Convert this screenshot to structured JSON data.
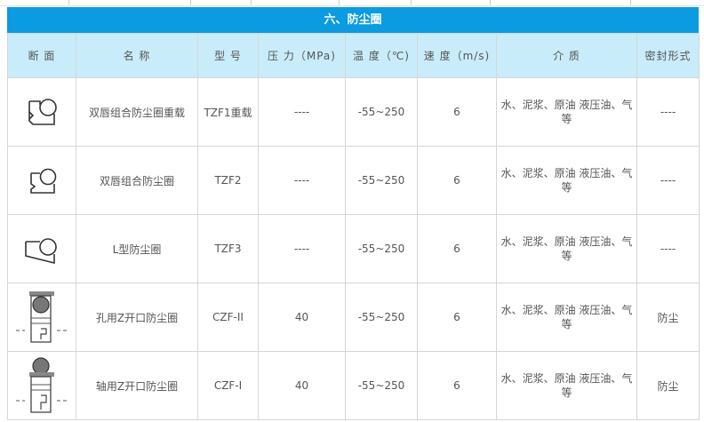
{
  "title": "六、防尘圈",
  "headers": [
    "断  面",
    "名  称",
    "型  号",
    "压  力（MPa)",
    "温  度（℃)",
    "速  度（m/s)",
    "介  质",
    "密封形式"
  ],
  "rows": [
    {
      "section_icon": "seal-profile-double-lip-heavy-icon",
      "name": "双唇组合防尘圈重载",
      "model": "TZF1重载",
      "pressure": "----",
      "temperature": "-55~250",
      "speed": "6",
      "medium": "水、泥浆、原油 液压油、气等",
      "seal_type": "----"
    },
    {
      "section_icon": "seal-profile-double-lip-icon",
      "name": "双唇组合防尘圈",
      "model": "TZF2",
      "pressure": "----",
      "temperature": "-55~250",
      "speed": "6",
      "medium": "水、泥浆、原油 液压油、气等",
      "seal_type": "----"
    },
    {
      "section_icon": "seal-profile-l-type-icon",
      "name": "L型防尘圈",
      "model": "TZF3",
      "pressure": "----",
      "temperature": "-55~250",
      "speed": "6",
      "medium": "水、泥浆、原油 液压油、气等",
      "seal_type": "----"
    },
    {
      "section_icon": "seal-profile-bore-z-split-icon",
      "name": "孔用Z开口防尘圈",
      "model": "CZF-II",
      "pressure": "40",
      "temperature": "-55~250",
      "speed": "6",
      "medium": "水、泥浆、原油 液压油、气等",
      "seal_type": "防尘"
    },
    {
      "section_icon": "seal-profile-shaft-z-split-icon",
      "name": "轴用Z开口防尘圈",
      "model": "CZF-I",
      "pressure": "40",
      "temperature": "-55~250",
      "speed": "6",
      "medium": "水、泥浆、原油 液压油、气等",
      "seal_type": "防尘"
    }
  ]
}
